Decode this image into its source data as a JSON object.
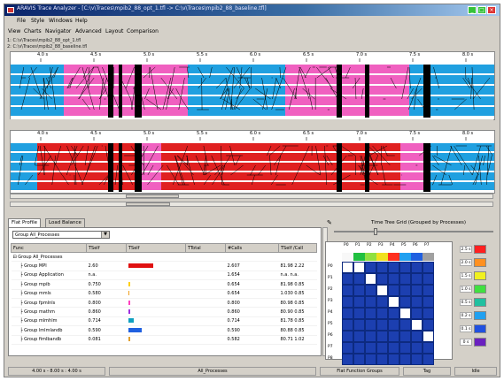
{
  "window": {
    "title": "ARAVIS Trace Analyzer - [C:\\v\\Traces\\mpib2_88_opt_1.tfl -> C:\\v\\Traces\\mpib2_88_baseline.tfl]",
    "controls": [
      "_",
      "□",
      "×"
    ]
  },
  "menubar": {
    "items": [
      "File",
      "Style",
      "Windows",
      "Help"
    ]
  },
  "menubar_secondary": {
    "items": [
      "View",
      "Charts",
      "Navigator",
      "Advanced",
      "Layout",
      "Comparison"
    ]
  },
  "files": [
    "1: C:\\v\\Traces\\mpib2_88_opt_1.tfl",
    "2: C:\\v\\Traces\\mpib2_88_baseline.tfl"
  ],
  "timeline1": {
    "labels": [
      "4.0 s",
      "4.5 s",
      "5.0 s",
      "5.5 s",
      "6.0 s",
      "6.5 s",
      "7.0 s",
      "7.5 s",
      "8.0 s"
    ]
  },
  "timeline2": {
    "labels": [
      "4.0 s",
      "4.5 s",
      "5.0 s",
      "5.5 s",
      "6.0 s",
      "6.5 s",
      "7.0 s",
      "7.5 s",
      "8.0 s"
    ]
  },
  "tabs": [
    "Flat Profile",
    "Load Balance"
  ],
  "profile": {
    "group_select": "Group All_Processes",
    "columns": [
      "Func",
      "TSelf",
      "TSelf",
      "TTotal",
      "#Calls",
      "TSelf /Call"
    ],
    "rows": [
      {
        "name": "Group All_Processes",
        "indent": 0,
        "tself": "",
        "bar": 0,
        "color": "",
        "c3": "",
        "calls": "",
        "c5": "",
        "c6": ""
      },
      {
        "name": "Group MPI",
        "indent": 1,
        "tself": "2.60",
        "bar": 1.0,
        "color": "#e01010",
        "c3": "",
        "calls": "2.607",
        "c5": "81.98",
        "c6": "2.22"
      },
      {
        "name": "Group Application",
        "indent": 1,
        "tself": "n.a.",
        "bar": 0,
        "color": "",
        "c3": "",
        "calls": "1.654",
        "c5": "n.a.",
        "c6": "n.a."
      },
      {
        "name": "Group mpib",
        "indent": 1,
        "tself": "0.750",
        "bar": 0.06,
        "color": "#ffd010",
        "c3": "",
        "calls": "0.654",
        "c5": "81.98",
        "c6": "0.85"
      },
      {
        "name": "Group mmls",
        "indent": 1,
        "tself": "0.580",
        "bar": 0.05,
        "color": "#f0a020",
        "c3": "",
        "calls": "0.654",
        "c5": "1.030",
        "c6": "0.85"
      },
      {
        "name": "Group fpmlnls",
        "indent": 1,
        "tself": "0.800",
        "bar": 0.06,
        "color": "#ff40c0",
        "c3": "",
        "calls": "0.800",
        "c5": "80.98",
        "c6": "0.85"
      },
      {
        "name": "Group mathm",
        "indent": 1,
        "tself": "0.860",
        "bar": 0.08,
        "color": "#a030e0",
        "c3": "",
        "calls": "0.860",
        "c5": "80.90",
        "c6": "0.85"
      },
      {
        "name": "Group mlmhlm",
        "indent": 1,
        "tself": "0.714",
        "bar": 0.22,
        "color": "#10a0c0",
        "c3": "",
        "calls": "0.714",
        "c5": "81.78",
        "c6": "0.85"
      },
      {
        "name": "Group lmlmlandb",
        "indent": 1,
        "tself": "0.590",
        "bar": 0.52,
        "color": "#2060e0",
        "c3": "",
        "calls": "0.590",
        "c5": "80.88",
        "c6": "0.85"
      },
      {
        "name": "Group fimlbandb",
        "indent": 1,
        "tself": "0.081",
        "bar": 0.07,
        "color": "#e0a030",
        "c3": "",
        "calls": "0.582",
        "c5": "80.71",
        "c6": "1.02"
      }
    ]
  },
  "matrix": {
    "title": "Time Tree Grid (Grouped by Processes)",
    "col_labels": [
      "P0",
      "P1",
      "P2",
      "P3",
      "P4",
      "P5",
      "P6",
      "P7"
    ],
    "row_labels": [
      "P0",
      "P1",
      "P2",
      "P3",
      "P4",
      "P5",
      "P6",
      "P7",
      "P8"
    ],
    "header_colors": [
      "#f8f8f8",
      "#20c040",
      "#90e040",
      "#f0e020",
      "#ff3020",
      "#20a0f0",
      "#2060e0",
      "#a0a0a0"
    ],
    "fill": "#1c3fb0",
    "diag": "#ffffff"
  },
  "legend": {
    "values": [
      "2.5 s",
      "2.0 s",
      "1.5 s",
      "1.0 s",
      "0.5 s",
      "0.2 s",
      "0.1 s",
      "0 s"
    ],
    "colors": [
      "#ff2020",
      "#ff9020",
      "#f0f020",
      "#40e040",
      "#20c0a0",
      "#20a0f0",
      "#2050e0",
      "#6a20c0"
    ]
  },
  "status": {
    "fields": [
      "4.00 s - 8.00 s : 4.00 s",
      "All_Processes",
      "Flat Function Groups",
      "Tag",
      "Idle"
    ]
  }
}
